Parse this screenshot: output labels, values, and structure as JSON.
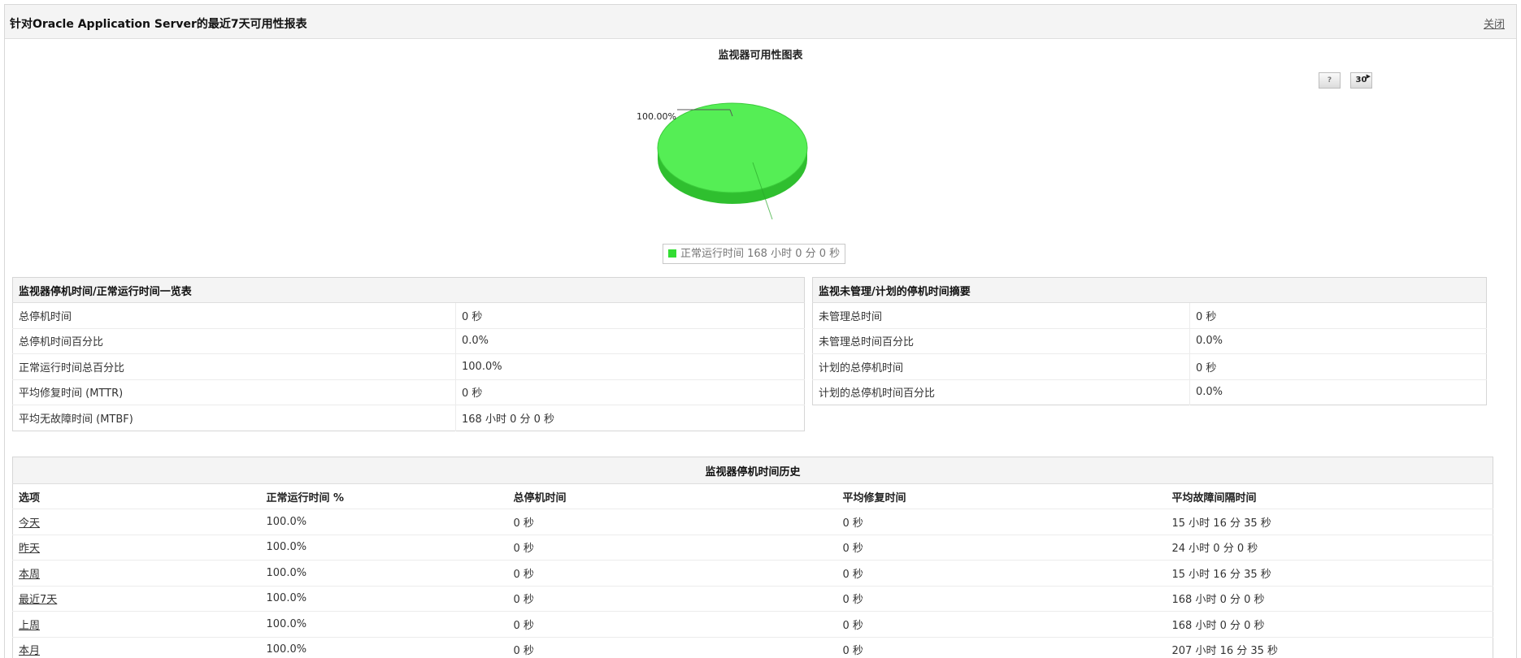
{
  "header": {
    "title": "针对Oracle Application Server的最近7天可用性报表",
    "close_label": "关闭"
  },
  "chart": {
    "title": "监视器可用性图表",
    "help_label": "?",
    "range_label": "30",
    "slice_label": "100.00%",
    "legend_label": "正常运行时间 168 小时 0 分 0 秒",
    "colors": {
      "uptime": "#33dd33"
    }
  },
  "chart_data": {
    "type": "pie",
    "title": "监视器可用性图表",
    "slices": [
      {
        "label": "正常运行时间 168 小时 0 分 0 秒",
        "value": 100.0,
        "color": "#33dd33"
      }
    ],
    "data_labels": [
      "100.00%"
    ],
    "legend_position": "bottom"
  },
  "downtime_summary": {
    "title": "监视器停机时间/正常运行时间一览表",
    "rows": [
      {
        "label": "总停机时间",
        "value": "0 秒"
      },
      {
        "label": "总停机时间百分比",
        "value": "0.0%"
      },
      {
        "label": "正常运行时间总百分比",
        "value": "100.0%"
      },
      {
        "label": "平均修复时间 (MTTR)",
        "value": "0 秒"
      },
      {
        "label": "平均无故障时间 (MTBF)",
        "value": "168 小时 0 分 0 秒"
      }
    ]
  },
  "unmanaged_summary": {
    "title": "监视未管理/计划的停机时间摘要",
    "rows": [
      {
        "label": "未管理总时间",
        "value": "0 秒"
      },
      {
        "label": "未管理总时间百分比",
        "value": "0.0%"
      },
      {
        "label": "计划的总停机时间",
        "value": "0 秒"
      },
      {
        "label": "计划的总停机时间百分比",
        "value": "0.0%"
      }
    ]
  },
  "history": {
    "title": "监视器停机时间历史",
    "columns": [
      "选项",
      "正常运行时间 %",
      "总停机时间",
      "平均修复时间",
      "平均故障间隔时间"
    ],
    "rows": [
      {
        "period": "今天",
        "uptime": "100.0%",
        "downtime": "0 秒",
        "mttr": "0 秒",
        "mtbf": "15 小时 16 分 35 秒"
      },
      {
        "period": "昨天",
        "uptime": "100.0%",
        "downtime": "0 秒",
        "mttr": "0 秒",
        "mtbf": "24 小时 0 分 0 秒"
      },
      {
        "period": "本周",
        "uptime": "100.0%",
        "downtime": "0 秒",
        "mttr": "0 秒",
        "mtbf": "15 小时 16 分 35 秒"
      },
      {
        "period": "最近7天",
        "uptime": "100.0%",
        "downtime": "0 秒",
        "mttr": "0 秒",
        "mtbf": "168 小时 0 分 0 秒"
      },
      {
        "period": "上周",
        "uptime": "100.0%",
        "downtime": "0 秒",
        "mttr": "0 秒",
        "mtbf": "168 小时 0 分 0 秒"
      },
      {
        "period": "本月",
        "uptime": "100.0%",
        "downtime": "0 秒",
        "mttr": "0 秒",
        "mtbf": "207 小时 16 分 35 秒"
      }
    ]
  }
}
